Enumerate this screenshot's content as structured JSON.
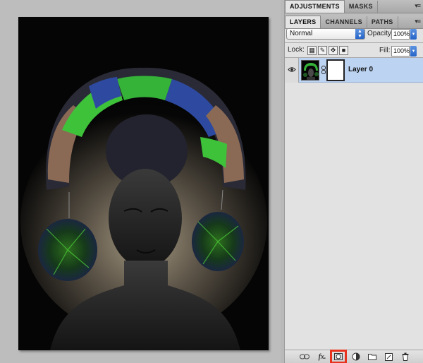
{
  "panels": {
    "adjustments_tab": "ADJUSTMENTS",
    "masks_tab": "MASKS",
    "menu_glyph": "▾≡"
  },
  "layers": {
    "tabs": [
      "LAYERS",
      "CHANNELS",
      "PATHS"
    ],
    "active_tab": "LAYERS",
    "blend_mode": "Normal",
    "opacity_label": "Opacity:",
    "opacity_value": "100%",
    "lock_label": "Lock:",
    "fill_label": "Fill:",
    "fill_value": "100%",
    "items": [
      {
        "name": "Layer 0",
        "visible": true,
        "selected": true,
        "has_mask": true
      }
    ]
  },
  "bottom_toolbar": {
    "buttons": [
      {
        "name": "link-layers",
        "glyph": "∞"
      },
      {
        "name": "add-layer-style",
        "glyph": "fx."
      },
      {
        "name": "add-layer-mask",
        "glyph": "◘",
        "highlighted": true
      },
      {
        "name": "new-adjustment-layer",
        "glyph": "◐."
      },
      {
        "name": "new-group",
        "glyph": "▭"
      },
      {
        "name": "new-layer",
        "glyph": "❐"
      },
      {
        "name": "delete-layer",
        "glyph": "🗑"
      }
    ],
    "highlight_color": "#e8331e"
  },
  "colors": {
    "selected_layer": "#bcd3f2",
    "panel_bg": "#e2e2e2",
    "canvas_bg": "#bdbdbd"
  }
}
